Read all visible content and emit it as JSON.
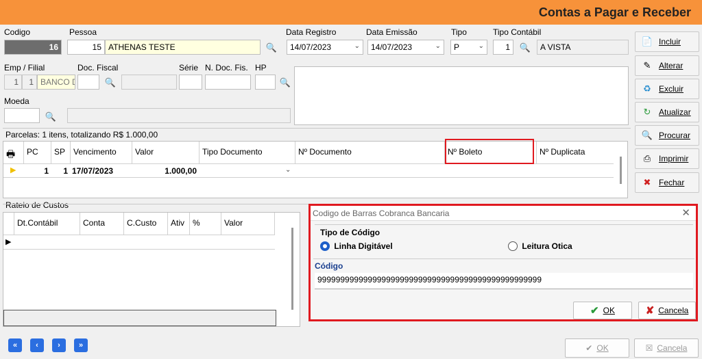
{
  "window": {
    "title": "Contas a Pagar e Receber"
  },
  "header": {
    "codigo_label": "Codigo",
    "codigo_value": "16",
    "pessoa_label": "Pessoa",
    "pessoa_code": "15",
    "pessoa_name": "ATHENAS TESTE",
    "data_registro_label": "Data Registro",
    "data_registro": "14/07/2023",
    "data_emissao_label": "Data Emissão",
    "data_emissao": "14/07/2023",
    "tipo_label": "Tipo",
    "tipo_value": "P",
    "tipo_contabil_label": "Tipo Contábil",
    "tipo_contabil_code": "1",
    "tipo_contabil_name": "A VISTA",
    "emp_label": "Emp / Filial",
    "emp_value": "1",
    "filial_value": "1",
    "banco_value": "BANCO D",
    "doc_fiscal_label": "Doc. Fiscal",
    "serie_label": "Série",
    "n_doc_fis_label": "N. Doc. Fis.",
    "hp_label": "HP",
    "moeda_label": "Moeda"
  },
  "sidebar": {
    "items": [
      {
        "label": "Incluir",
        "icon": "page-icon"
      },
      {
        "label": "Alterar",
        "icon": "edit-icon"
      },
      {
        "label": "Excluir",
        "icon": "delete-icon"
      },
      {
        "label": "Atualizar",
        "icon": "refresh-icon"
      },
      {
        "label": "Procurar",
        "icon": "binoculars-icon"
      },
      {
        "label": "Imprimir",
        "icon": "printer-icon"
      },
      {
        "label": "Fechar",
        "icon": "close-window-icon"
      }
    ]
  },
  "parcelas": {
    "summary": "Parcelas: 1 itens, totalizando R$ 1.000,00",
    "columns": [
      "PC",
      "SP",
      "Vencimento",
      "Valor",
      "Tipo Documento",
      "Nº Documento",
      "Nº Boleto",
      "Nº Duplicata"
    ],
    "row": {
      "pc": "1",
      "sp": "1",
      "vencimento": "17/07/2023",
      "valor": "1.000,00"
    }
  },
  "rateio": {
    "title": "Rateio de Custos",
    "columns": [
      "Dt.Contábil",
      "Conta",
      "C.Custo",
      "Ativ",
      "%",
      "Valor"
    ]
  },
  "dialog": {
    "title": "Codigo de Barras Cobranca Bancaria",
    "tipo_label": "Tipo de Código",
    "option1": "Linha Digitável",
    "option2": "Leitura Otica",
    "codigo_label": "Código",
    "codigo_value": "9999999999999999999999999999999999999999999999999",
    "ok_label": "OK",
    "cancel_label": "Cancela"
  },
  "footer": {
    "ok_label": "OK",
    "cancel_label": "Cancela"
  },
  "colors": {
    "title_bar": "#f7923a",
    "highlight": "#e0191f",
    "nav": "#2b6ee0"
  }
}
